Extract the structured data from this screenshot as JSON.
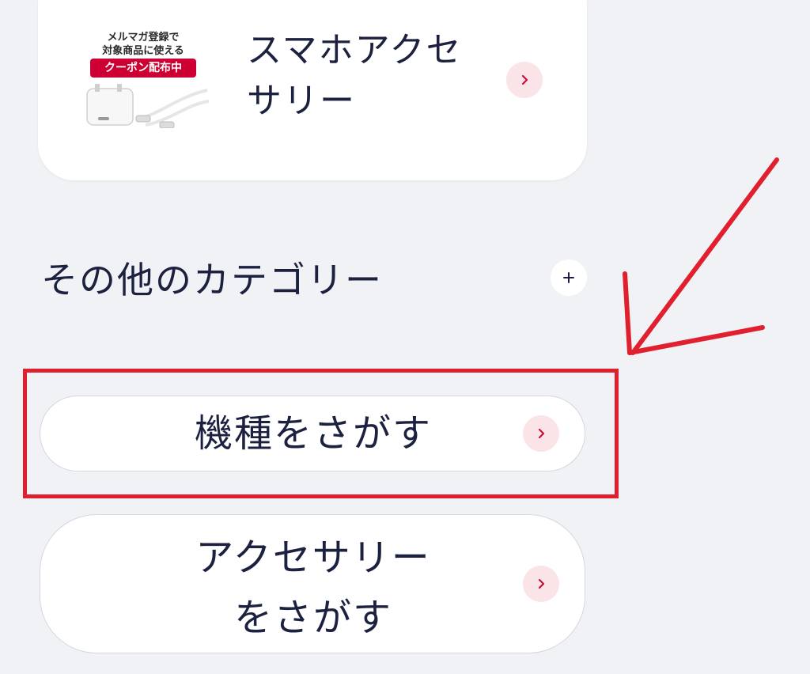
{
  "accessory_card": {
    "promo_line1": "メルマガ登録で",
    "promo_line2": "対象商品に使える",
    "coupon_badge": "クーポン配布中",
    "title": "スマホアクセサリー",
    "icon": "chevron-right-icon"
  },
  "other_categories": {
    "title": "その他のカテゴリー",
    "toggle_icon": "plus-icon"
  },
  "buttons": {
    "search_device": "機種をさがす",
    "search_accessory_line1": "アクセサリー",
    "search_accessory_line2": "をさがす"
  },
  "colors": {
    "page_background": "#f1f2f5",
    "accent": "#c8103a",
    "accent_soft": "#fbe4e8",
    "annotation_red": "#e0202f",
    "text": "#1d2140"
  }
}
